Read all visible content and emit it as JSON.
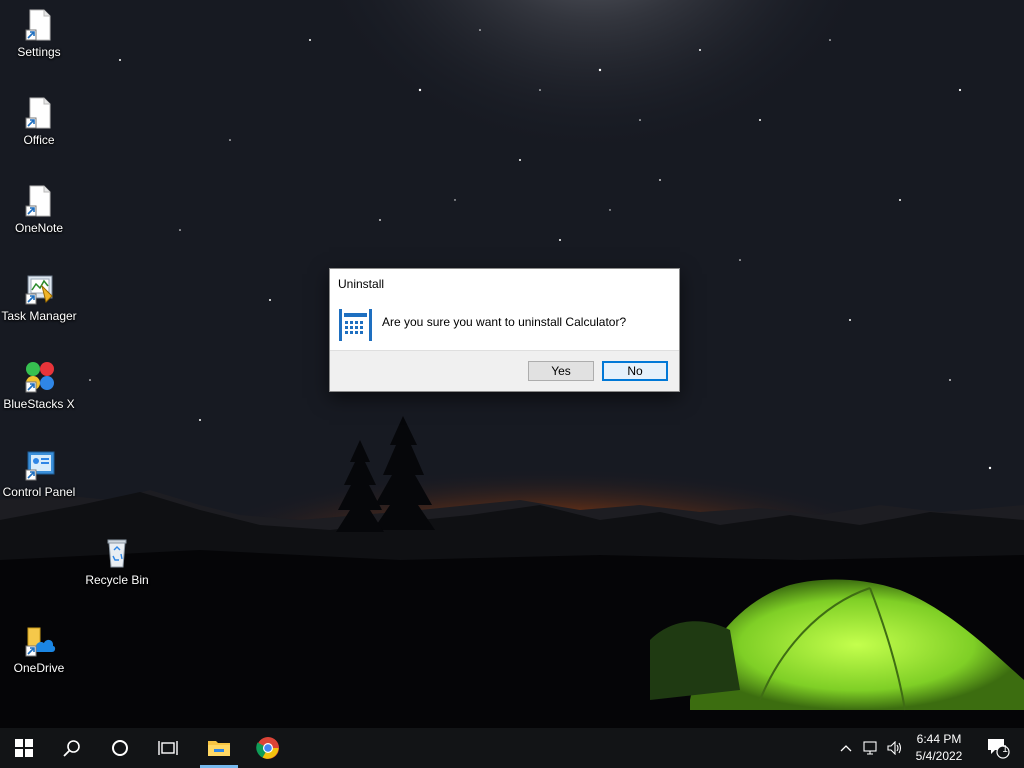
{
  "desktop": {
    "icons": [
      {
        "label": "Settings"
      },
      {
        "label": "Office"
      },
      {
        "label": "OneNote"
      },
      {
        "label": "Task Manager"
      },
      {
        "label": "BlueStacks X"
      },
      {
        "label": "Control Panel"
      },
      {
        "label": "Recycle Bin"
      },
      {
        "label": "OneDrive"
      }
    ]
  },
  "dialog": {
    "title": "Uninstall",
    "message": "Are you sure you want to uninstall Calculator?",
    "yes_label": "Yes",
    "no_label": "No",
    "icon": "calculator-icon"
  },
  "taskbar": {
    "pinned": [
      "windows-start-icon",
      "search-icon",
      "cortana-icon",
      "task-view-icon",
      "file-explorer-icon",
      "chrome-icon"
    ],
    "clock_time": "6:44 PM",
    "clock_date": "5/4/2022",
    "notification_count": "1"
  },
  "colors": {
    "accent": "#0078d7",
    "taskbar": "#121416",
    "tent": "#9be53a"
  }
}
